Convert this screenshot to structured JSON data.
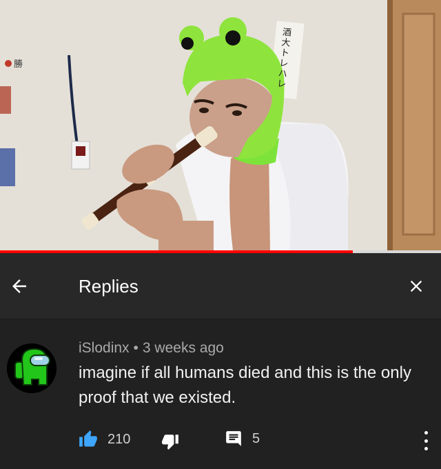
{
  "video": {
    "progress_fraction": 0.8,
    "poster_text": "酒大トレハレ",
    "wall_sign": "勝"
  },
  "header": {
    "title": "Replies",
    "back_icon": "arrow-left-icon",
    "close_icon": "close-icon"
  },
  "comment": {
    "author": "iSlodinx",
    "separator": "•",
    "time": "3 weeks ago",
    "text": "imagine if all humans died and this is the only proof that we existed.",
    "avatar_icon": "among-us-crewmate-icon",
    "avatar_color": "#22c51a",
    "likes": "210",
    "replies": "5",
    "like_color": "#3ea6ff"
  }
}
